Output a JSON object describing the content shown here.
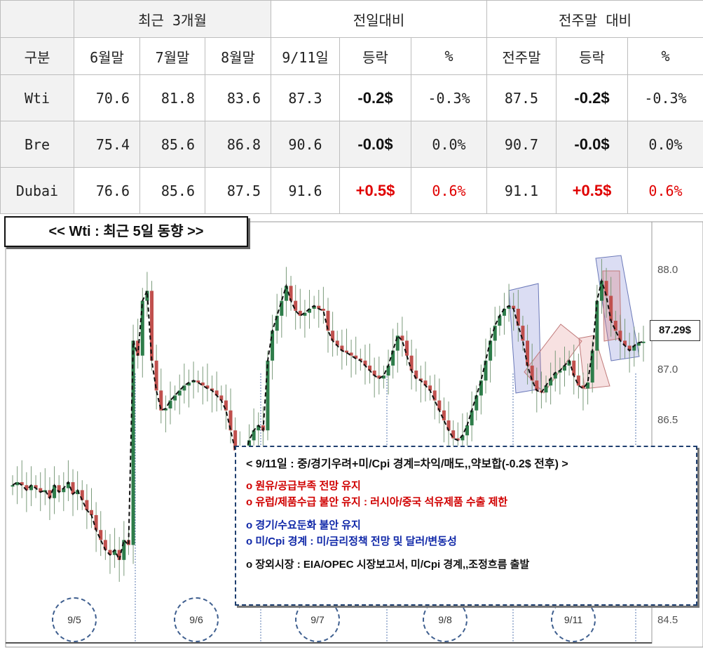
{
  "table": {
    "header_recent": "최근 3개월",
    "header_daily": "전일대비",
    "header_weekly": "전주말 대비",
    "col_category": "구분",
    "col_jun": "6월말",
    "col_jul": "7월말",
    "col_aug": "8월말",
    "col_date": "9/11일",
    "col_change": "등락",
    "col_pct": "%",
    "col_prev_week": "전주말",
    "col_change2": "등락",
    "col_pct2": "%",
    "rows": [
      {
        "name": "Wti",
        "jun": "70.6",
        "jul": "81.8",
        "aug": "83.6",
        "today": "87.3",
        "chg": "-0.2$",
        "pct": "-0.3%",
        "prevwk": "87.5",
        "chg2": "-0.2$",
        "pct2": "-0.3%"
      },
      {
        "name": "Bre",
        "jun": "75.4",
        "jul": "85.6",
        "aug": "86.8",
        "today": "90.6",
        "chg": "-0.0$",
        "pct": "0.0%",
        "prevwk": "90.7",
        "chg2": "-0.0$",
        "pct2": "0.0%"
      },
      {
        "name": "Dubai",
        "jun": "76.6",
        "jul": "85.6",
        "aug": "87.5",
        "today": "91.6",
        "chg": "+0.5$",
        "pct": "0.6%",
        "prevwk": "91.1",
        "chg2": "+0.5$",
        "pct2": "0.6%"
      }
    ]
  },
  "chart_data": {
    "type": "line",
    "title": "<< Wti : 최근 5일 동향 >>",
    "last_price_label": "87.29$",
    "yticks": [
      "88.0",
      "87.0",
      "86.5",
      "84.5"
    ],
    "ylim": [
      84.5,
      88.2
    ],
    "categories": [
      "9/5",
      "9/6",
      "9/7",
      "9/8",
      "9/11"
    ],
    "series": [
      {
        "values": [
          85.85,
          85.88,
          85.85,
          85.8,
          85.85,
          85.82,
          85.78,
          85.8,
          85.72,
          85.85,
          85.78,
          85.82,
          85.88,
          85.76,
          85.8,
          85.7,
          85.6,
          85.55,
          85.4,
          85.3,
          85.2,
          85.15,
          85.2,
          85.1,
          85.3,
          85.25,
          87.3,
          87.15,
          87.7,
          87.8,
          87.1,
          86.8,
          86.6,
          86.62,
          86.7,
          86.75,
          86.8,
          86.85,
          86.88,
          86.9,
          86.88,
          86.85,
          86.82,
          86.8,
          86.75,
          86.7,
          86.6,
          86.4,
          86.2,
          86.05,
          86.15,
          86.3,
          86.4,
          86.45,
          86.4,
          87.1,
          87.4,
          87.55,
          87.7,
          87.85,
          87.7,
          87.6,
          87.55,
          87.58,
          87.62,
          87.65,
          87.62,
          87.6,
          87.4,
          87.3,
          87.25,
          87.2,
          87.18,
          87.15,
          87.12,
          87.1,
          87.05,
          87.0,
          86.95,
          86.92,
          86.95,
          87.05,
          87.2,
          87.35,
          87.3,
          87.15,
          87.0,
          86.92,
          86.9,
          86.85,
          86.8,
          86.7,
          86.6,
          86.5,
          86.4,
          86.32,
          86.3,
          86.35,
          86.45,
          86.6,
          86.75,
          86.9,
          87.1,
          87.3,
          87.45,
          87.55,
          87.62,
          87.65,
          87.62,
          87.45,
          87.3,
          87.05,
          86.9,
          86.8,
          86.78,
          86.85,
          86.92,
          86.98,
          87.0,
          87.05,
          87.1,
          86.95,
          86.85,
          86.82,
          86.88,
          87.2,
          87.7,
          87.9,
          87.75,
          87.5,
          87.4,
          87.3,
          87.25,
          87.2,
          87.25,
          87.28,
          87.29
        ]
      }
    ]
  },
  "news": {
    "headline": "< 9/11일 : 중/경기우려+미/Cpi 경계=차익/매도,,약보합(-0.2$ 전후) >",
    "items": [
      {
        "text": "o 원유/공급부족 전망 유지",
        "color": "red"
      },
      {
        "text": "o 유럽/제품수급 불안 유지 : 러시아/중국 석유제품 수출 제한",
        "color": "red"
      },
      {
        "text": "o 경기/수요둔화 불안 유지",
        "color": "blue"
      },
      {
        "text": "o 미/Cpi 경계 : 미/금리정책 전망 및 달러/변동성",
        "color": "blue"
      },
      {
        "text": "o 장외시장 : EIA/OPEC 시장보고서, 미/Cpi 경계,,조정흐름 출발",
        "color": "black"
      }
    ]
  },
  "colors": {
    "up": "#2e7d4a",
    "down": "#c0504d",
    "accent_red": "#e00000",
    "accent_blue": "#1028a8"
  }
}
